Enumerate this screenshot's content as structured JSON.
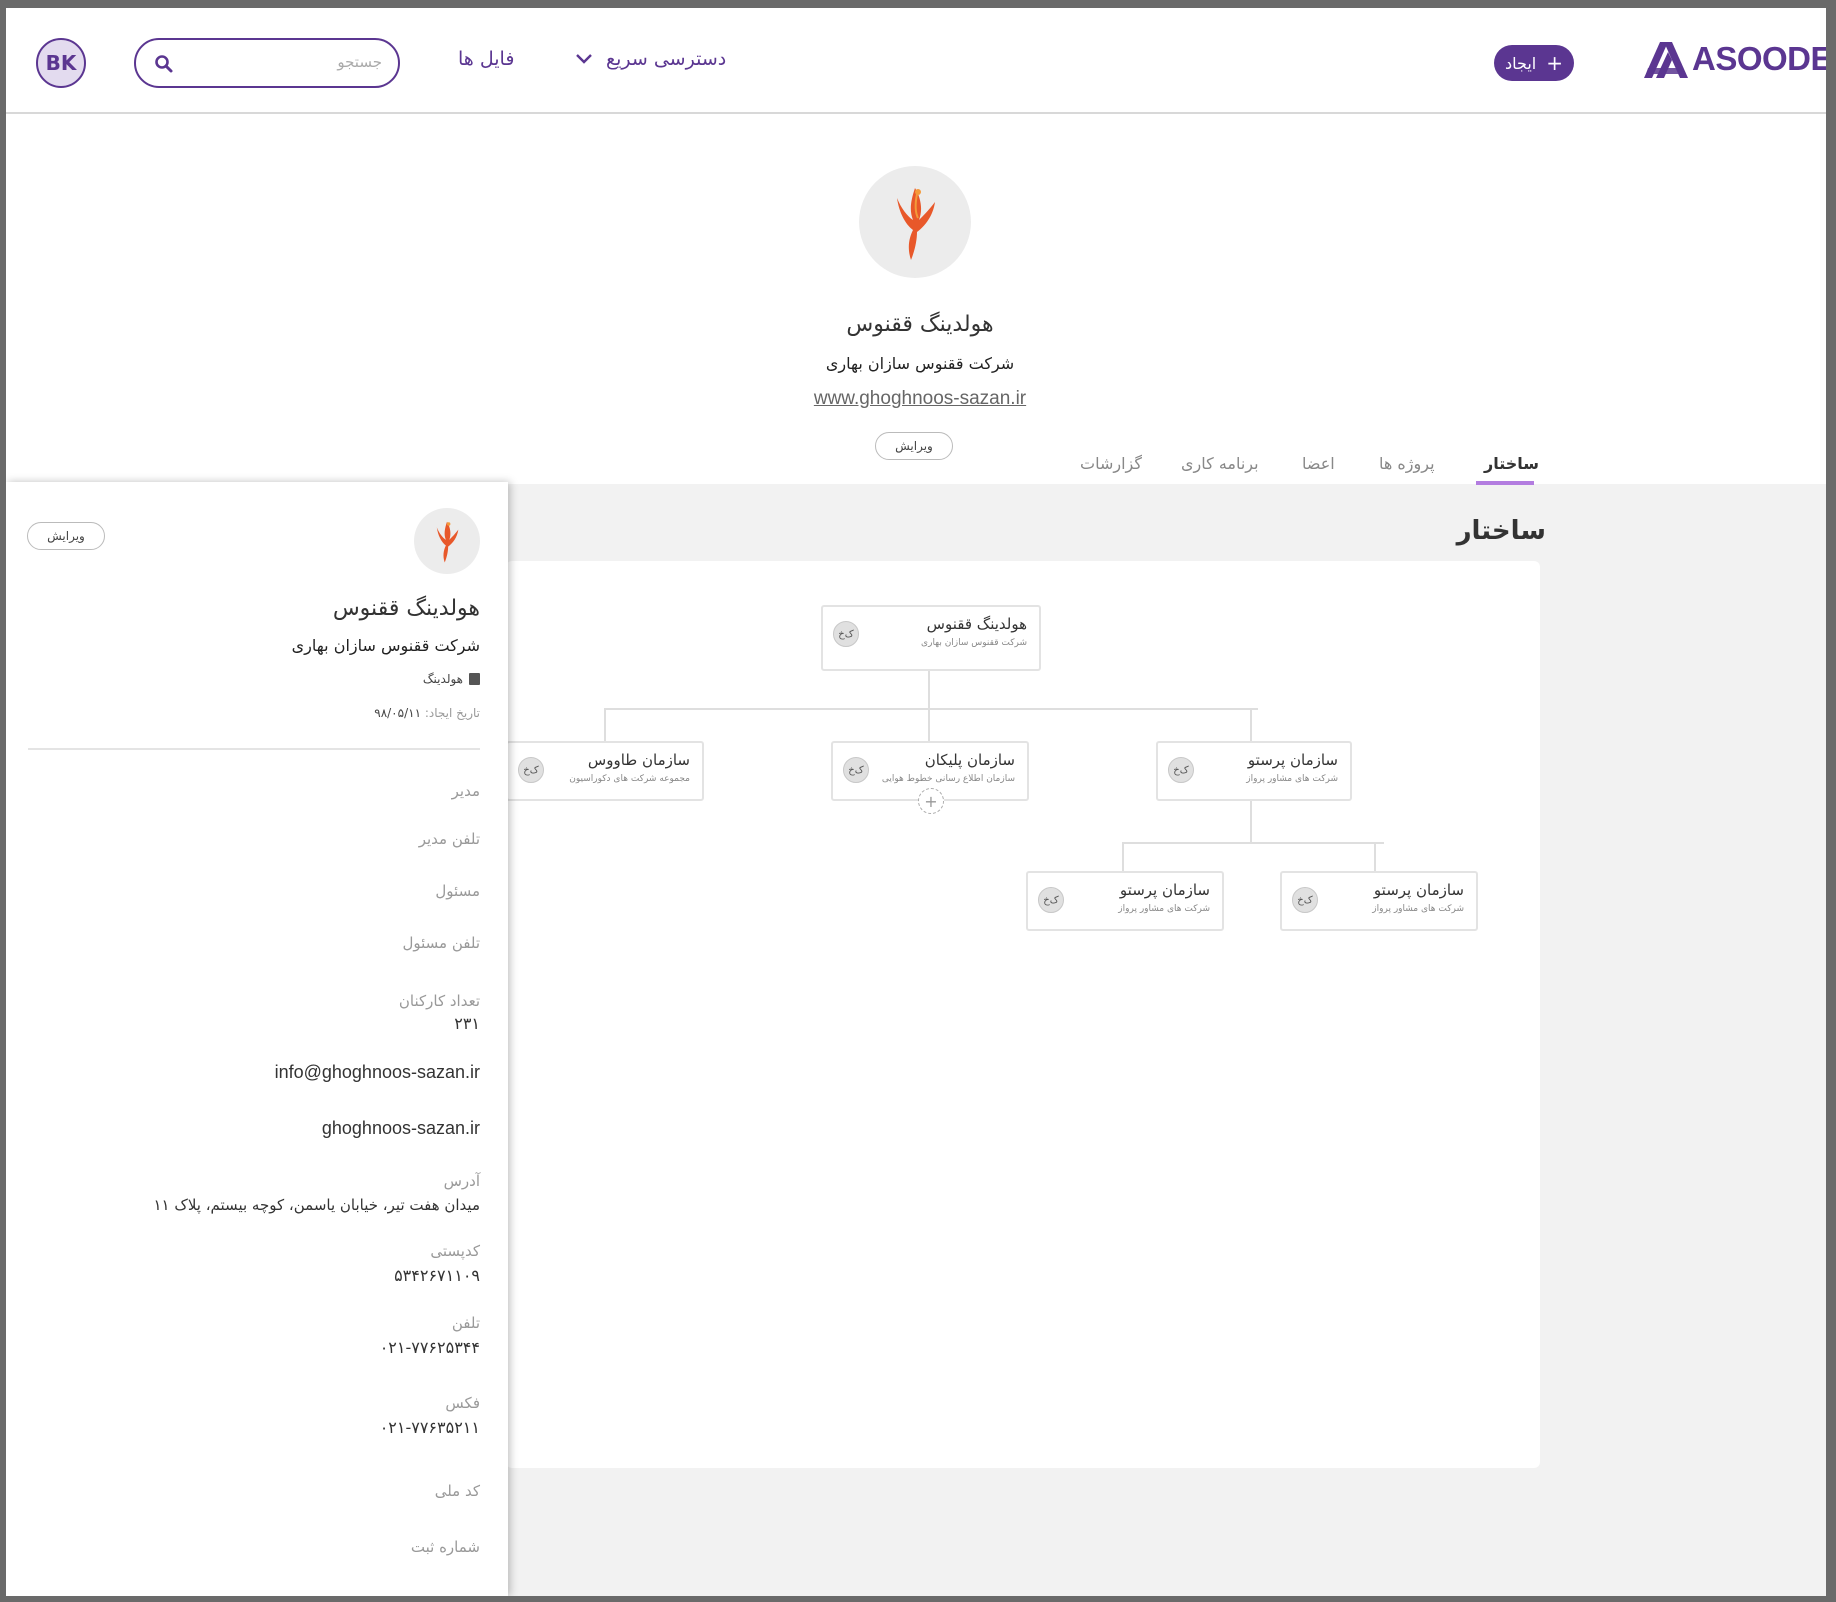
{
  "header": {
    "avatar_initials": "BK",
    "search_placeholder": "جستجو",
    "nav_files": "فایل ها",
    "nav_quick_access": "دسترسی سریع",
    "create_label": "ایجاد",
    "logo_text": "ASOODE",
    "brand_color": "#5b3691"
  },
  "profile": {
    "title": "هولدینگ ققنوس",
    "subtitle": "شرکت ققنوس سازان بهاری",
    "website": "www.ghoghnoos-sazan.ir",
    "edit_label": "ویرایش"
  },
  "tabs": [
    {
      "label": "ساختار",
      "active": true
    },
    {
      "label": "پروژه ها",
      "active": false
    },
    {
      "label": "اعضا",
      "active": false
    },
    {
      "label": "برنامه کاری",
      "active": false
    },
    {
      "label": "گزارشات",
      "active": false
    }
  ],
  "structure": {
    "title": "ساختار",
    "badge_label": "ک‌خ",
    "nodes": [
      {
        "title": "هولدینگ ققنوس",
        "subtitle": "شرکت ققنوس سازان بهاری"
      },
      {
        "title": "سازمان پرستو",
        "subtitle": "شرکت های مشاور پرواز"
      },
      {
        "title": "سازمان پلیکان",
        "subtitle": "سازمان اطلاع رسانی خطوط هوایی"
      },
      {
        "title": "سازمان طاووس",
        "subtitle": "مجموعه شرکت های دکوراسیون"
      },
      {
        "title": "سازمان پرستو",
        "subtitle": "شرکت های مشاور پرواز"
      },
      {
        "title": "سازمان پرستو",
        "subtitle": "شرکت های مشاور پرواز"
      }
    ]
  },
  "panel": {
    "edit_label": "ویرایش",
    "title": "هولدینگ ققنوس",
    "subtitle": "شرکت ققنوس سازان بهاری",
    "type_label": "هولدینگ",
    "created_label": "تاریخ ایجاد:",
    "created_value": "۹۸/۰۵/۱۱",
    "manager_label": "مدیر",
    "manager_phone_label": "تلفن مدیر",
    "responsible_label": "مسئول",
    "responsible_phone_label": "تلفن مسئول",
    "employees_label": "تعداد کارکنان",
    "employees_value": "۲۳۱",
    "email": "info@ghoghnoos-sazan.ir",
    "site": "ghoghnoos-sazan.ir",
    "address_label": "آدرس",
    "address_value": "میدان هفت تیر، خیابان یاسمن، کوچه بیستم، پلاک ۱۱",
    "postal_label": "کدپستی",
    "postal_value": "۵۳۴۲۶۷۱۱۰۹",
    "phone_label": "تلفن",
    "phone_value": "۰۲۱-۷۷۶۲۵۳۴۴",
    "fax_label": "فکس",
    "fax_value": "۰۲۱-۷۷۶۳۵۲۱۱",
    "national_id_label": "کد ملی",
    "registration_label": "شماره ثبت"
  }
}
